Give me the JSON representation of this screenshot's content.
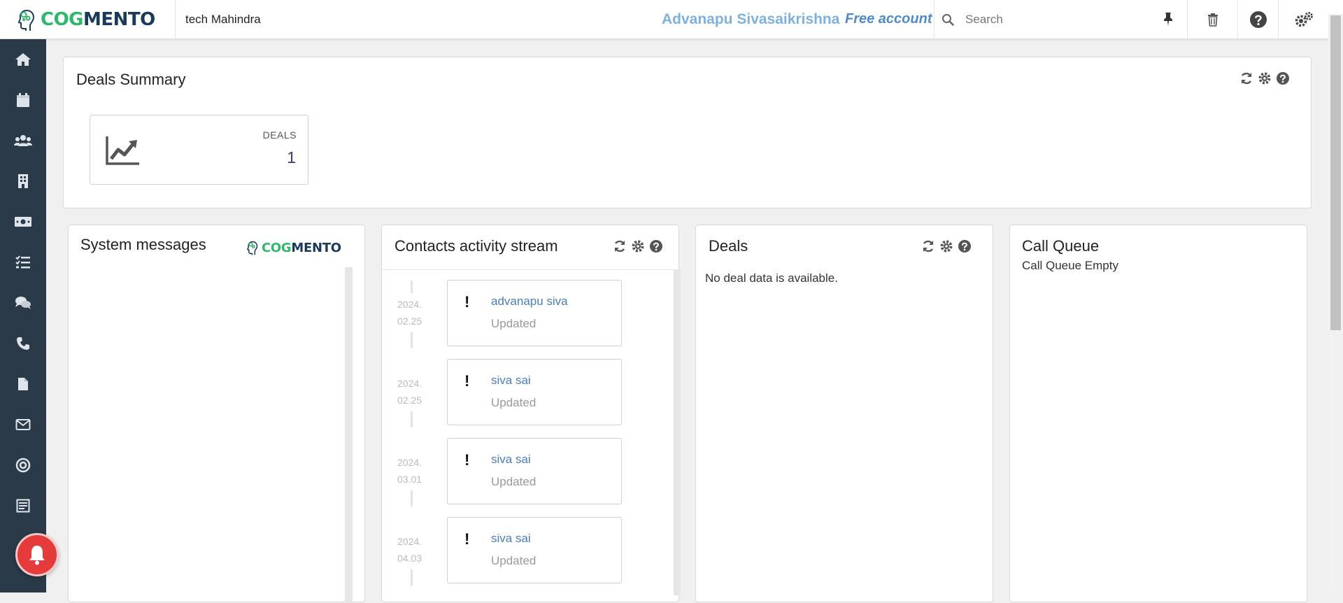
{
  "header": {
    "logo": {
      "part1": "COG",
      "part2": "MENTO"
    },
    "org_name": "tech Mahindra",
    "user_name": "Advanapu Sivasaikrishna",
    "account_type": "Free account",
    "search_placeholder": "Search"
  },
  "sidebar": {
    "icons": [
      "home-icon",
      "calendar-icon",
      "contacts-icon",
      "companies-icon",
      "deals-icon",
      "tasks-icon",
      "cases-icon",
      "calls-icon",
      "documents-icon",
      "email-icon",
      "campaigns-icon",
      "forms-icon"
    ]
  },
  "deals_summary": {
    "title": "Deals Summary",
    "stat_label": "DEALS",
    "stat_value": "1"
  },
  "system_messages": {
    "title": "System messages",
    "logo": {
      "part1": "COG",
      "part2": "MENTO"
    }
  },
  "contacts_activity": {
    "title": "Contacts activity stream",
    "entries": [
      {
        "year": "2024.",
        "date": "02.25",
        "name": "advanapu siva",
        "status": "Updated"
      },
      {
        "year": "2024.",
        "date": "02.25",
        "name": "siva sai",
        "status": "Updated"
      },
      {
        "year": "2024.",
        "date": "03.01",
        "name": "siva sai",
        "status": "Updated"
      },
      {
        "year": "2024.",
        "date": "04.03",
        "name": "siva sai",
        "status": "Updated"
      }
    ]
  },
  "deals": {
    "title": "Deals",
    "empty_message": "No deal data is available."
  },
  "call_queue": {
    "title": "Call Queue",
    "empty_message": "Call Queue Empty"
  },
  "colors": {
    "sidebar_bg": "#2b3a48",
    "brand_green": "#2fb86c",
    "brand_navy": "#1a3a5c",
    "link_blue": "#4a7ebb",
    "notification_red": "#e63b3b"
  }
}
